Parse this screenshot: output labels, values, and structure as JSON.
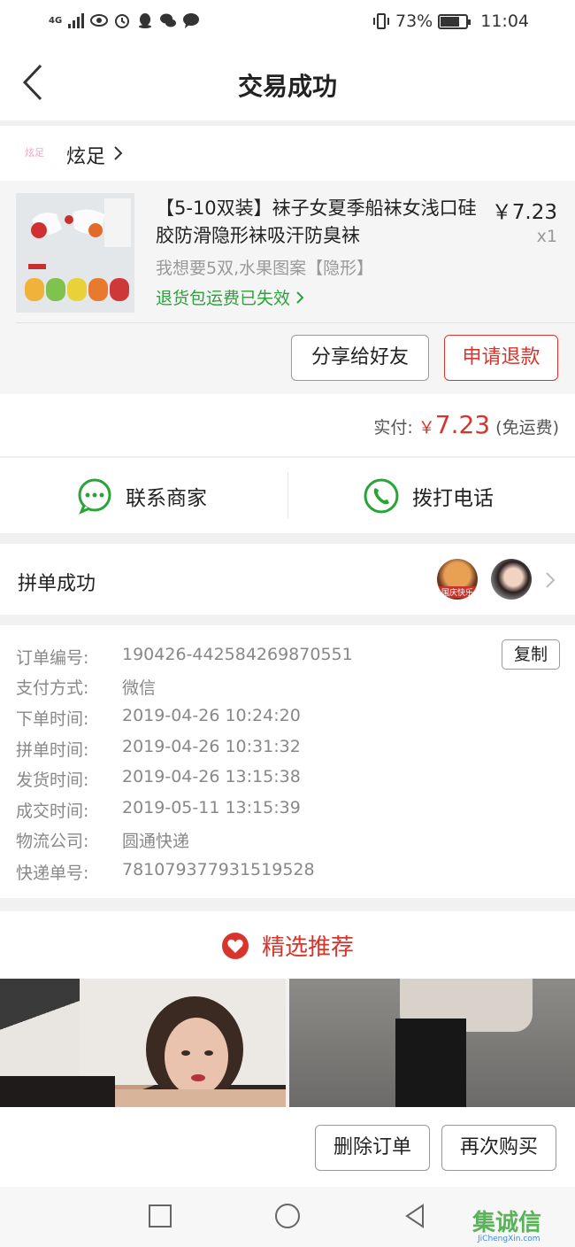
{
  "status_bar": {
    "network": "4G",
    "battery_percent": "73%",
    "battery_level": 0.73,
    "time": "11:04",
    "icons": [
      "signal-icon",
      "eye-icon",
      "alarm-icon",
      "qq-icon",
      "wechat-icon",
      "message-icon",
      "vibrate-icon",
      "battery-icon"
    ]
  },
  "header": {
    "title": "交易成功"
  },
  "store": {
    "name": "炫足",
    "logo_text": "炫足"
  },
  "product": {
    "title": "【5-10双装】袜子女夏季船袜女浅口硅胶防滑隐形袜吸汗防臭袜",
    "price": "￥7.23",
    "quantity": "x1",
    "spec": "我想要5双,水果图案【隐形】",
    "refund_note": "退货包运费已失效",
    "share_button": "分享给好友",
    "refund_button": "申请退款"
  },
  "payment": {
    "label": "实付:",
    "currency": "￥",
    "amount": "7.23",
    "shipping": "(免运费)"
  },
  "contact": {
    "merchant_label": "联系商家",
    "phone_label": "拨打电话"
  },
  "group_buy": {
    "label": "拼单成功",
    "avatar1_caption": "国庆快乐"
  },
  "order_info": {
    "copy_button": "复制",
    "rows": [
      {
        "key": "订单编号:",
        "value": "190426-442584269870551"
      },
      {
        "key": "支付方式:",
        "value": "微信"
      },
      {
        "key": "下单时间:",
        "value": "2019-04-26 10:24:20"
      },
      {
        "key": "拼单时间:",
        "value": "2019-04-26 10:31:32"
      },
      {
        "key": "发货时间:",
        "value": "2019-04-26 13:15:38"
      },
      {
        "key": "成交时间:",
        "value": "2019-05-11 13:15:39"
      },
      {
        "key": "物流公司:",
        "value": "圆通快递"
      },
      {
        "key": "快递单号:",
        "value": "781079377931519528"
      }
    ]
  },
  "recommend": {
    "title": "精选推荐"
  },
  "actions": {
    "delete_order": "删除订单",
    "buy_again": "再次购买"
  },
  "watermark": {
    "text": "集诚信",
    "sub": "JiChengXin.com"
  },
  "colors": {
    "accent_red": "#d9342c",
    "green": "#2aa33a",
    "gray_text": "#888888"
  }
}
